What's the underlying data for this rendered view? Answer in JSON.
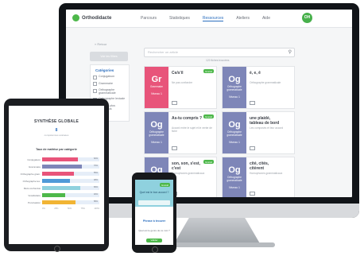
{
  "app": {
    "logo": "Orthodidacte",
    "avatar": "OH"
  },
  "nav": [
    "Parcours",
    "Statistiques",
    "Ressources",
    "Ateliers",
    "Aide"
  ],
  "sidebar": {
    "back": "« Retour",
    "filters_button": "Voir les filtres",
    "categories_title": "Catégories",
    "categories": [
      "Conjugaison",
      "Grammaire",
      "Orthographe grammaticale",
      "Orthographe lexicale",
      "Mots les plus confondus"
    ]
  },
  "search": {
    "placeholder": "Rechercher un article",
    "result_count": "120 fiches trouvées"
  },
  "cards": [
    {
      "abbr": "Gr",
      "category": "Grammaire",
      "level": "Niveau 1",
      "title": "Ce/s'il",
      "desc": "Ne pas confondre",
      "badge": "Gratuit",
      "color": "#e8547a"
    },
    {
      "abbr": "Og",
      "category": "Orthographe grammaticale",
      "level": "Niveau 1",
      "title": "è, e, ê",
      "desc": "Orthographe grammaticale",
      "badge": "",
      "color": "#7e86b8"
    },
    {
      "abbr": "Og",
      "category": "Orthographe grammaticale",
      "level": "Niveau 1",
      "title": "As-tu compris ?",
      "desc": "Accord entre le sujet et le verbe de fiche",
      "badge": "Gratuit",
      "color": "#7e86b8"
    },
    {
      "abbr": "Og",
      "category": "Orthographe grammaticale",
      "level": "Niveau 1",
      "title": "une plaidé, tableau de bord",
      "desc": "Les composés et leur accord",
      "badge": "",
      "color": "#7e86b8"
    },
    {
      "abbr": "Og",
      "category": "Orthographe grammaticale",
      "level": "Niveau 1",
      "title": "son, son, s'est, c'est",
      "desc": "Homophones grammaticaux",
      "badge": "Gratuit",
      "color": "#7e86b8"
    },
    {
      "abbr": "Og",
      "category": "Orthographe grammaticale",
      "level": "Niveau 1",
      "title": "cité, cités, citèrent",
      "desc": "Homophones grammaticaux",
      "badge": "",
      "color": "#7e86b8"
    }
  ],
  "tablet": {
    "title": "SYNTHÈSE GLOBALE",
    "count": "8",
    "count_label": "compétences évaluées",
    "chart_title": "Taux de maîtrise par catégorie",
    "bars": [
      {
        "label": "Conjugaison",
        "value": 62,
        "color": "#e8547a",
        "text": "62%"
      },
      {
        "label": "Grammaire",
        "value": 70,
        "color": "#7e86b8",
        "text": "70%"
      },
      {
        "label": "Orthographe gram.",
        "value": 55,
        "color": "#e8547a",
        "text": "55%"
      },
      {
        "label": "Orthographe lex.",
        "value": 48,
        "color": "#4f9ad8",
        "text": "48%"
      },
      {
        "label": "Mots confondus",
        "value": 66,
        "color": "#8fd1de",
        "text": "66%"
      },
      {
        "label": "Vocabulaire",
        "value": 40,
        "color": "#4db84a",
        "text": "40%"
      },
      {
        "label": "Ponctuation",
        "value": 58,
        "color": "#f1b434",
        "text": "58%"
      }
    ],
    "axis": [
      "0%",
      "25%",
      "50%",
      "75%",
      "100%"
    ]
  },
  "phone": {
    "badge": "Gratuit",
    "question": "Quel est le bon accord ?",
    "answer": "Phrase à trouver",
    "explanation": "Quel est le genre de ce mot ?",
    "button": "Valider"
  }
}
